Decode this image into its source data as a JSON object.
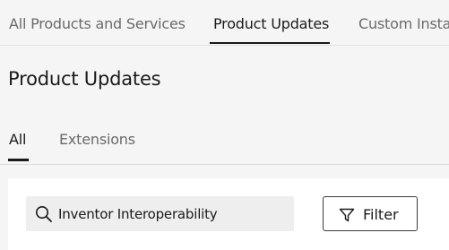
{
  "top_tabs": [
    {
      "label": "All Products and Services"
    },
    {
      "label": "Product Updates"
    },
    {
      "label": "Custom Insta"
    }
  ],
  "page": {
    "title": "Product Updates"
  },
  "sub_tabs": [
    {
      "label": "All"
    },
    {
      "label": "Extensions"
    }
  ],
  "search": {
    "value": "Inventor Interoperability",
    "icon": "search-icon"
  },
  "filter": {
    "label": "Filter",
    "icon": "filter-icon"
  }
}
